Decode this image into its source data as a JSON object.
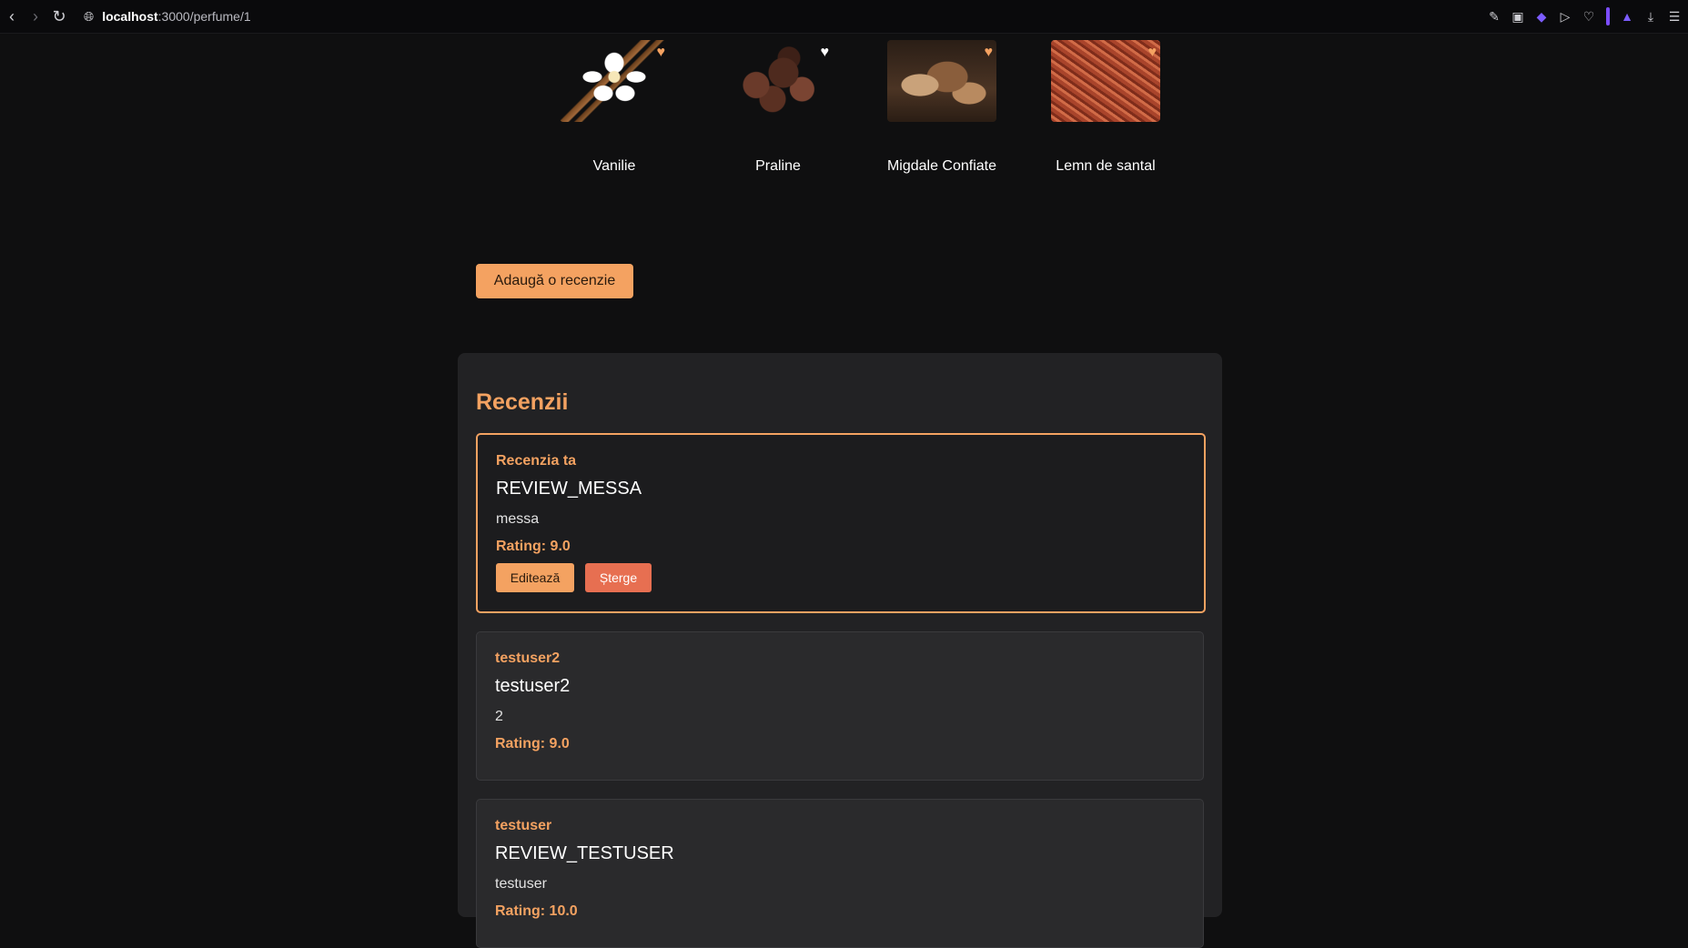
{
  "browser": {
    "url_host": "localhost",
    "url_path": ":3000/perfume/1",
    "back_icon": "back-icon",
    "forward_icon": "forward-icon",
    "reload_icon": "reload-icon"
  },
  "notes": [
    {
      "label": "Vanilie",
      "heart_color": "#f4a261"
    },
    {
      "label": "Praline",
      "heart_color": "#ffffff"
    },
    {
      "label": "Migdale Confiate",
      "heart_color": "#f4a261"
    },
    {
      "label": "Lemn de santal",
      "heart_color": "#f4a261"
    }
  ],
  "add_review_label": "Adaugă o recenzie",
  "reviews_section": {
    "title": "Recenzii",
    "items": [
      {
        "author": "Recenzia ta",
        "title": "REVIEW_MESSA",
        "body": "messa",
        "rating": "Rating: 9.0",
        "edit_label": "Editează",
        "delete_label": "Șterge"
      },
      {
        "author": "testuser2",
        "title": "testuser2",
        "body": "2",
        "rating": "Rating: 9.0"
      },
      {
        "author": "testuser",
        "title": "REVIEW_TESTUSER",
        "body": "testuser",
        "rating": "Rating: 10.0"
      }
    ]
  },
  "colors": {
    "accent": "#f4a261",
    "danger": "#e76f51",
    "background": "#0f0f10",
    "panel": "#222224"
  }
}
